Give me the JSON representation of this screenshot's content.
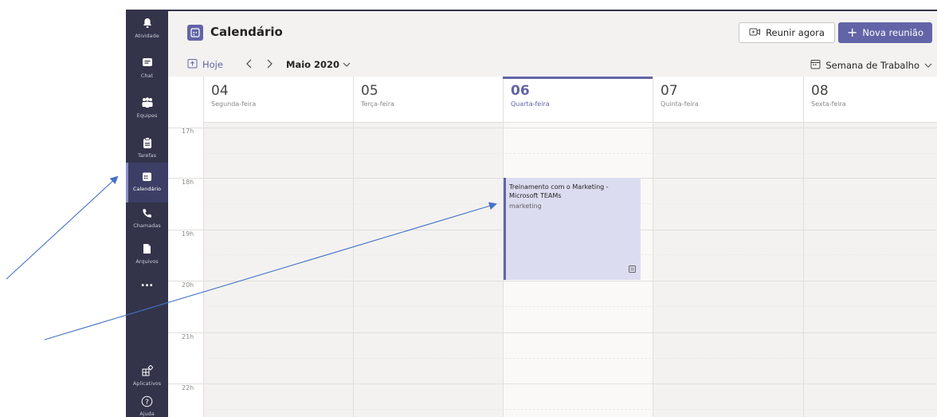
{
  "rail": {
    "items": [
      {
        "label": "Atividade",
        "icon": "bell-icon"
      },
      {
        "label": "Chat",
        "icon": "chat-icon"
      },
      {
        "label": "Equipes",
        "icon": "teams-icon"
      },
      {
        "label": "Tarefas",
        "icon": "tasks-icon"
      },
      {
        "label": "Calendário",
        "icon": "calendar-icon",
        "active": true
      },
      {
        "label": "Chamadas",
        "icon": "phone-icon"
      },
      {
        "label": "Arquivos",
        "icon": "file-icon"
      }
    ],
    "more": "...",
    "bottom": [
      {
        "label": "Aplicativos",
        "icon": "apps-icon"
      },
      {
        "label": "Ajuda",
        "icon": "help-icon"
      }
    ]
  },
  "header": {
    "title": "Calendário",
    "meet_now": "Reunir agora",
    "new_meeting": "Nova reunião"
  },
  "nav": {
    "today": "Hoje",
    "month": "Maio 2020",
    "view": "Semana de Trabalho"
  },
  "days": [
    {
      "num": "04",
      "name": "Segunda-feira"
    },
    {
      "num": "05",
      "name": "Terça-feira"
    },
    {
      "num": "06",
      "name": "Quarta-feira",
      "today": true
    },
    {
      "num": "07",
      "name": "Quinta-feira"
    },
    {
      "num": "08",
      "name": "Sexta-feira"
    }
  ],
  "hours": [
    "17h",
    "18h",
    "19h",
    "20h",
    "21h",
    "22h"
  ],
  "event": {
    "title": "Treinamento com o Marketing - Microsoft TEAMs",
    "channel": "marketing",
    "day": "06",
    "start": "18h",
    "end": "20h"
  },
  "colors": {
    "accent": "#6264a7",
    "rail": "#33344a",
    "event_bg": "#dcdcf1",
    "annotation": "#4472c4"
  }
}
